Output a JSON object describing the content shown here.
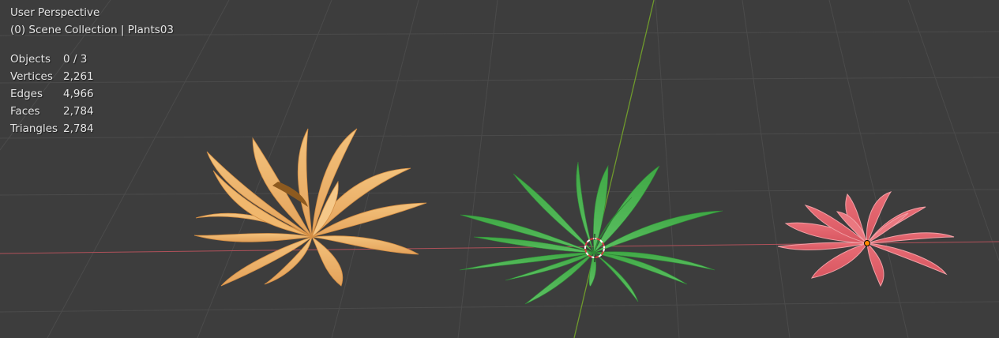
{
  "viewport": {
    "view_name": "User Perspective",
    "collection_info": "(0) Scene Collection | Plants03"
  },
  "stats": [
    {
      "label": "Objects",
      "value": "0 / 3"
    },
    {
      "label": "Vertices",
      "value": "2,261"
    },
    {
      "label": "Edges",
      "value": "4,966"
    },
    {
      "label": "Faces",
      "value": "2,784"
    },
    {
      "label": "Triangles",
      "value": "2,784"
    }
  ],
  "colors": {
    "background": "#3d3d3d",
    "grid": "#4a4a4a",
    "x_axis": "#b0515a",
    "y_axis": "#6f9a2c",
    "plant_orange": "#eba85a",
    "plant_green": "#4fb24f",
    "plant_red": "#df5d66",
    "origin_dot": "#ff8800"
  },
  "icons": {
    "cursor": "3d-cursor-icon",
    "origin": "object-origin-icon"
  }
}
